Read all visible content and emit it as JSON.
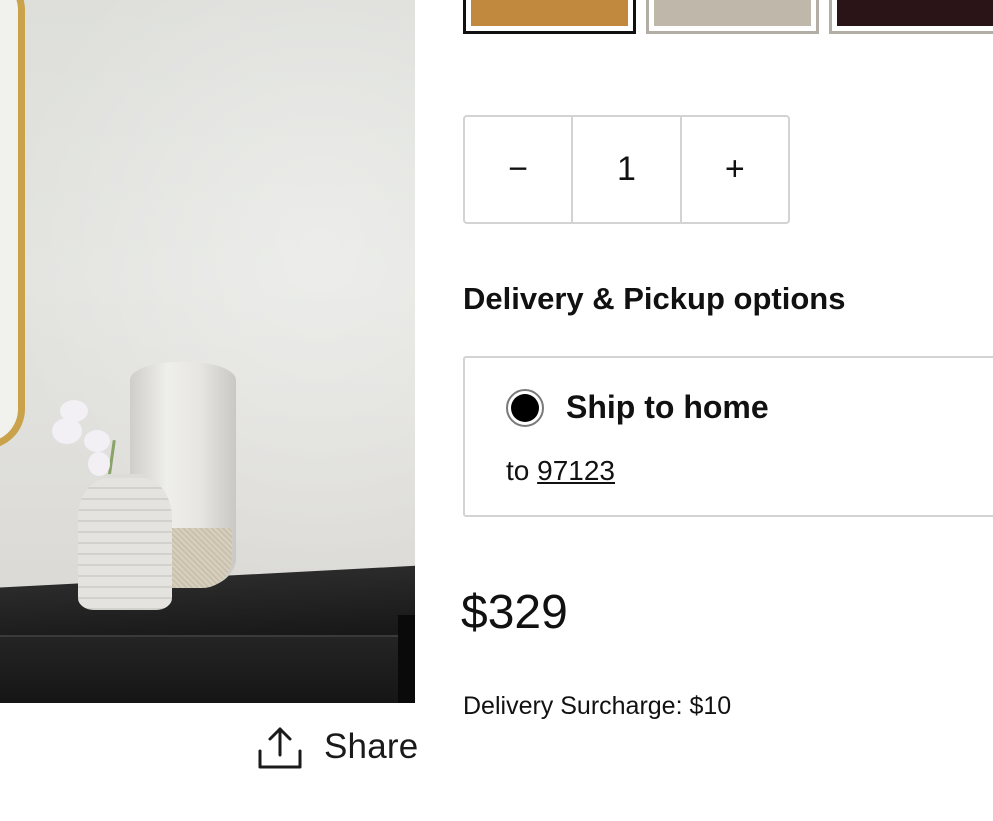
{
  "colors": {
    "swatch_1": "#c1893d",
    "swatch_2": "#bfb8aa",
    "swatch_3": "#2a1418",
    "selected_border": "#111111",
    "border": "#d3d3d3"
  },
  "share": {
    "label": "Share",
    "icon": "share-upload-icon"
  },
  "quantity": {
    "decrement": "−",
    "value": "1",
    "increment": "+"
  },
  "delivery": {
    "heading": "Delivery & Pickup options",
    "option_title": "Ship to home",
    "to_prefix": "to",
    "zip": "97123"
  },
  "price": "$329",
  "surcharge": "Delivery Surcharge: $10"
}
